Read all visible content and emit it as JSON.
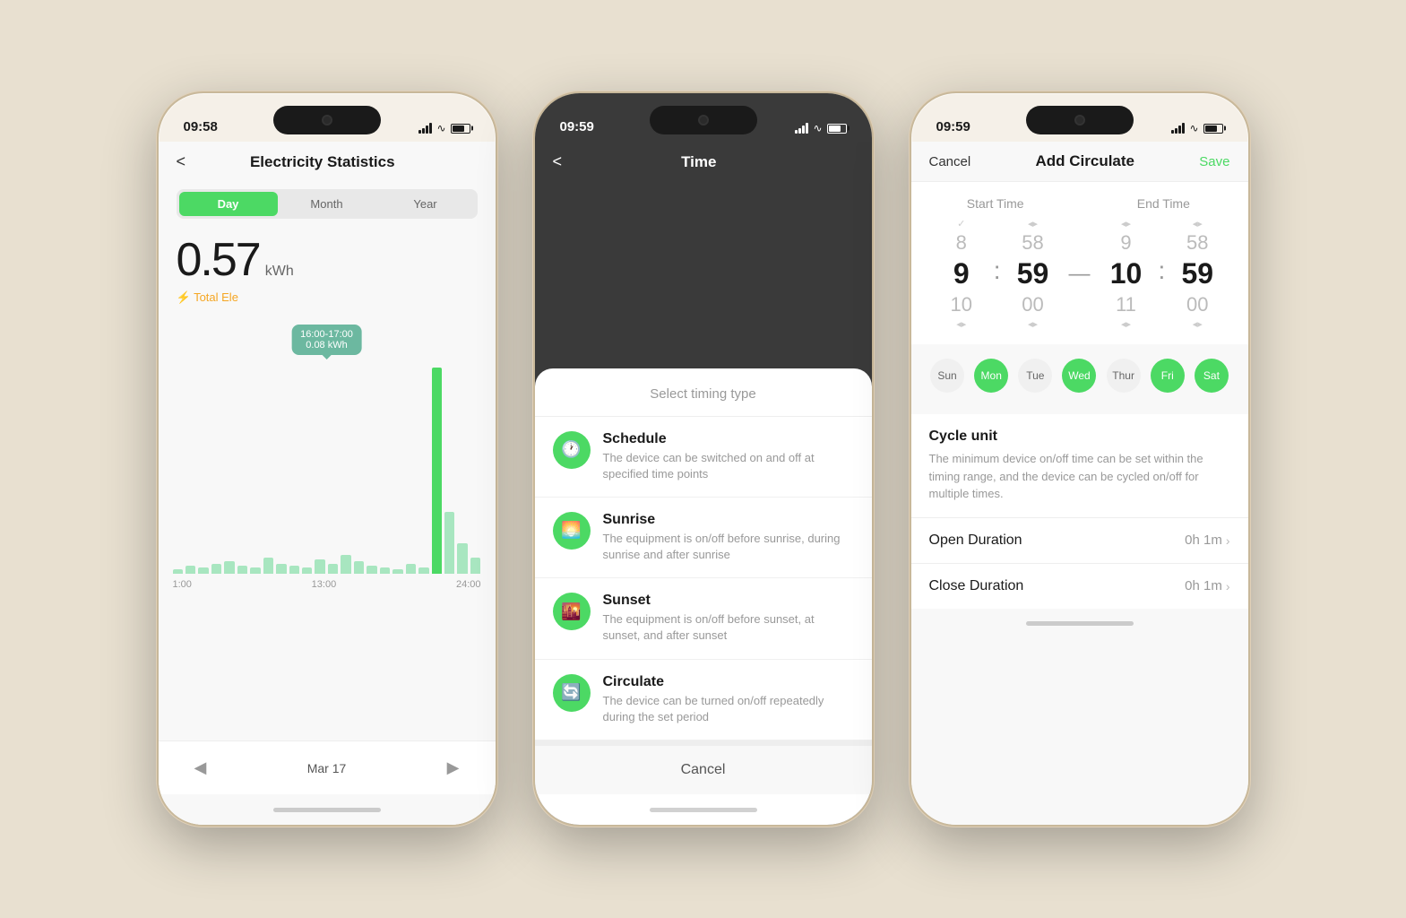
{
  "phone1": {
    "status": {
      "time": "09:58"
    },
    "header": {
      "title": "Electricity Statistics",
      "back": "<"
    },
    "tabs": [
      "Day",
      "Month",
      "Year"
    ],
    "active_tab": "Day",
    "value": "0.57",
    "unit": "kWh",
    "total_label": "⚡ Total Ele",
    "tooltip": {
      "label": "16:00-17:00",
      "value": "0.08 kWh"
    },
    "chart_labels": [
      "1:00",
      "13:00",
      "24:00"
    ],
    "bars": [
      2,
      4,
      3,
      5,
      6,
      4,
      3,
      8,
      5,
      4,
      3,
      7,
      5,
      9,
      6,
      4,
      3,
      2,
      5,
      3,
      100,
      30,
      15,
      8
    ],
    "nav": {
      "date": "Mar 17",
      "prev": "◀",
      "next": "▶"
    }
  },
  "phone2": {
    "status": {
      "time": "09:59"
    },
    "header": {
      "title": "Time",
      "back": "<"
    },
    "sheet_title": "Select timing type",
    "options": [
      {
        "id": "schedule",
        "icon": "🕐",
        "title": "Schedule",
        "desc": "The device can be switched on and off at specified time points"
      },
      {
        "id": "sunrise",
        "icon": "🌅",
        "title": "Sunrise",
        "desc": "The equipment is on/off before sunrise, during sunrise and after sunrise"
      },
      {
        "id": "sunset",
        "icon": "🌇",
        "title": "Sunset",
        "desc": "The equipment is on/off before sunset, at sunset, and after sunset"
      },
      {
        "id": "circulate",
        "icon": "🔄",
        "title": "Circulate",
        "desc": "The device can be turned on/off repeatedly during the set period"
      }
    ],
    "cancel_label": "Cancel"
  },
  "phone3": {
    "status": {
      "time": "09:59"
    },
    "header": {
      "title": "Add Circulate",
      "cancel": "Cancel",
      "save": "Save"
    },
    "time_labels": [
      "Start Time",
      "End Time"
    ],
    "start_time": {
      "above": "✓",
      "above_min": "◂ ▸",
      "prev_h": "8",
      "prev_m": "58",
      "curr_h": "9",
      "curr_m": "59",
      "next_h": "10",
      "next_m": "00",
      "below_h": "◂ ▸",
      "below_m": "◂ ▸"
    },
    "end_time": {
      "prev_h": "9",
      "prev_m": "58",
      "curr_h": "10",
      "curr_m": "59",
      "next_h": "11",
      "next_m": "00"
    },
    "days": [
      "Sun",
      "Mon",
      "Tue",
      "Wed",
      "Thur",
      "Fri",
      "Sat"
    ],
    "active_days": [
      "Mon",
      "Wed",
      "Fri",
      "Sat"
    ],
    "cycle_unit_title": "Cycle unit",
    "cycle_unit_desc": "The minimum device on/off time can be set within the timing range, and the device can be cycled on/off for multiple times.",
    "open_duration_label": "Open Duration",
    "open_duration_value": "0h 1m",
    "close_duration_label": "Close Duration",
    "close_duration_value": "0h 1m"
  }
}
